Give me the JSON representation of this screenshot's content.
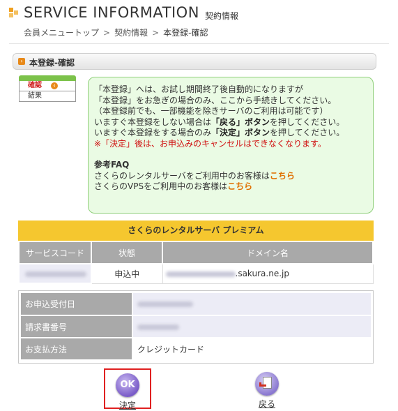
{
  "header": {
    "title": "SERVICE INFORMATION",
    "subtitle": "契約情報",
    "breadcrumb": {
      "item1": "会員メニュートップ",
      "sep": ">",
      "item2": "契約情報",
      "current": "本登録-確認"
    }
  },
  "section": {
    "heading": "本登録-確認"
  },
  "steps": {
    "current": "確認",
    "next": "結果"
  },
  "info": {
    "line1": "「本登録」へは、お試し期間終了後自動的になりますが",
    "line2": "「本登録」をお急ぎの場合のみ、ここから手続きしてください。",
    "line3": "（本登録前でも、一部機能を除きサーバのご利用は可能です）",
    "line4_pre": "いますぐ本登録をしない場合は",
    "line4_bold": "「戻る」ボタン",
    "line4_post": "を押してください。",
    "line5_pre": "いますぐ本登録をする場合のみ",
    "line5_bold": "「決定」ボタン",
    "line5_post": "を押してください。",
    "warning": "※「決定」後は、お申込みのキャンセルはできなくなります。",
    "faq_title": "参考FAQ",
    "faq1_text": "さくらのレンタルサーバをご利用中のお客様は",
    "faq1_link": "こちら",
    "faq2_text": "さくらのVPSをご利用中のお客様は",
    "faq2_link": "こちら"
  },
  "plan": {
    "name": "さくらのレンタルサーバ プレミアム",
    "columns": [
      "サービスコード",
      "状態",
      "ドメイン名"
    ],
    "status": "申込中",
    "domain_suffix": ".sakura.ne.jp"
  },
  "details": {
    "rows": [
      {
        "label": "お申込受付日",
        "value": ""
      },
      {
        "label": "請求書番号",
        "value": ""
      },
      {
        "label": "お支払方法",
        "value": "クレジットカード"
      }
    ]
  },
  "buttons": {
    "ok_icon_text": "OK",
    "ok_label": "決定",
    "back_label": "戻る"
  }
}
